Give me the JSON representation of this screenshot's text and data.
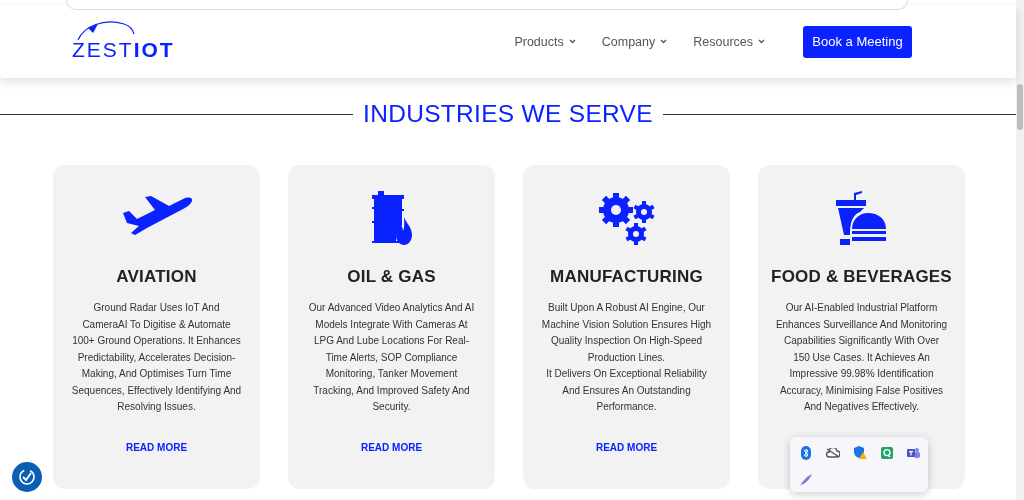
{
  "header": {
    "logo": {
      "light": "ZEST",
      "bold": "IOT"
    },
    "nav": [
      {
        "label": "Products"
      },
      {
        "label": "Company"
      },
      {
        "label": "Resources"
      }
    ],
    "cta": "Book a Meeting"
  },
  "section_title": "INDUSTRIES WE SERVE",
  "cards": [
    {
      "title": "AVIATION",
      "description": "Ground Radar Uses IoT And CameraAI To Digitise & Automate 100+ Ground Operations. It Enhances Predictability, Accelerates Decision-Making, And Optimises Turn Time Sequences, Effectively Identifying And Resolving Issues.",
      "link": "READ MORE"
    },
    {
      "title": "OIL & GAS",
      "description": "Our Advanced Video Analytics And AI Models Integrate With Cameras At LPG And Lube Locations For Real-Time Alerts, SOP Compliance Monitoring, Tanker Movement Tracking, And Improved Safety And Security.",
      "link": "READ MORE"
    },
    {
      "title": "MANUFACTURING",
      "description": "Built Upon A Robust AI Engine, Our Machine Vision Solution Ensures High Quality Inspection On High-Speed Production Lines.\nIt Delivers On Exceptional Reliability And Ensures An Outstanding Performance.",
      "link": "READ MORE"
    },
    {
      "title": "FOOD & BEVERAGES",
      "description": "Our AI-Enabled Industrial Platform Enhances Surveillance And Monitoring Capabilities Significantly With Over 150 Use Cases. It Achieves An Impressive 99.98% Identification Accuracy, Minimising False Positives And Negatives Effectively."
    }
  ]
}
